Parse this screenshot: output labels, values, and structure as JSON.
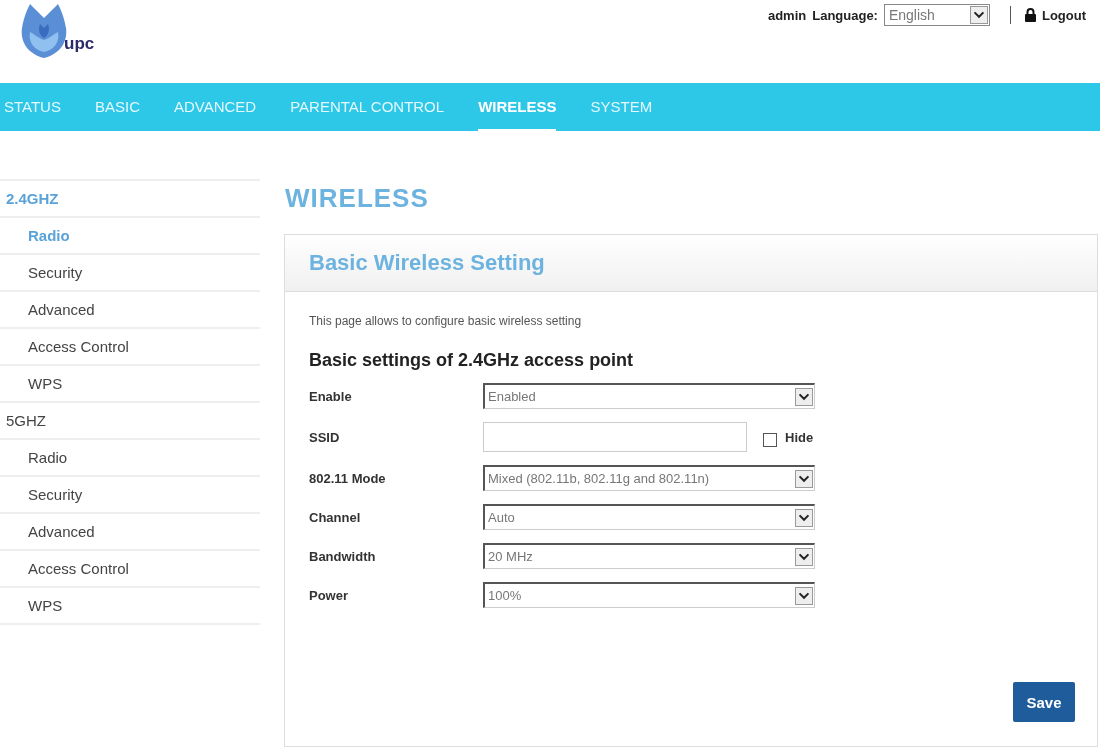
{
  "header": {
    "logo": {
      "text": "upc"
    },
    "user": "admin",
    "language": {
      "label": "Language:",
      "value": "English"
    },
    "logout": "Logout"
  },
  "nav": [
    {
      "label": "STATUS",
      "selected": false
    },
    {
      "label": "BASIC",
      "selected": false
    },
    {
      "label": "ADVANCED",
      "selected": false
    },
    {
      "label": "PARENTAL CONTROL",
      "selected": false
    },
    {
      "label": "WIRELESS",
      "selected": true
    },
    {
      "label": "SYSTEM",
      "selected": false
    }
  ],
  "sidebar": [
    {
      "label": "2.4GHZ",
      "selected": true,
      "children": [
        {
          "label": "Radio",
          "selected": true
        },
        {
          "label": "Security",
          "selected": false
        },
        {
          "label": "Advanced",
          "selected": false
        },
        {
          "label": "Access Control",
          "selected": false
        },
        {
          "label": "WPS",
          "selected": false
        }
      ]
    },
    {
      "label": "5GHZ",
      "selected": false,
      "children": [
        {
          "label": "Radio",
          "selected": false
        },
        {
          "label": "Security",
          "selected": false
        },
        {
          "label": "Advanced",
          "selected": false
        },
        {
          "label": "Access Control",
          "selected": false
        },
        {
          "label": "WPS",
          "selected": false
        }
      ]
    }
  ],
  "page_title": "WIRELESS",
  "panel": {
    "title": "Basic Wireless Setting",
    "description": "This page allows to configure basic wireless setting",
    "section_title": "Basic settings of 2.4GHz access point",
    "fields": [
      {
        "label": "Enable",
        "kind": "select",
        "value": "Enabled"
      },
      {
        "label": "SSID",
        "kind": "text",
        "checkbox": {
          "label": "Hide",
          "checked": false
        }
      },
      {
        "label": "802.11 Mode",
        "kind": "select",
        "value": "Mixed (802.11b, 802.11g and 802.11n)"
      },
      {
        "label": "Channel",
        "kind": "select",
        "value": "Auto"
      },
      {
        "label": "Bandwidth",
        "kind": "select",
        "value": "20 MHz"
      },
      {
        "label": "Power",
        "kind": "select",
        "value": "100%"
      }
    ],
    "save": "Save"
  }
}
